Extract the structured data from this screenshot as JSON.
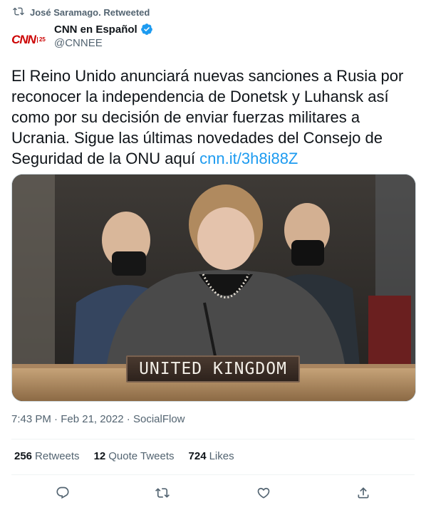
{
  "retweet": {
    "label": "José Saramago. Retweeted",
    "icon": "retweet-icon"
  },
  "author": {
    "display_name": "CNN en Español",
    "handle": "@CNNEE",
    "verified": true,
    "avatar_logo": "CNN 25"
  },
  "tweet": {
    "text": "El Reino Unido anunciará nuevas sanciones a Rusia por reconocer la independencia de Donetsk y Luhansk así como por su decisión de enviar fuerzas militares a Ucrania. Sigue las últimas novedades del Consejo de Seguridad de la ONU aquí ",
    "link": "cnn.it/3h8i88Z"
  },
  "media": {
    "nameplate": "UNITED KINGDOM"
  },
  "meta": {
    "time": "7:43 PM",
    "date": "Feb 21, 2022",
    "source": "SocialFlow"
  },
  "stats": {
    "retweets_count": "256",
    "retweets_label": "Retweets",
    "quotes_count": "12",
    "quotes_label": "Quote Tweets",
    "likes_count": "724",
    "likes_label": "Likes"
  },
  "colors": {
    "link": "#1d9bf0",
    "secondary_text": "#536471",
    "primary_text": "#0f1419",
    "verified": "#1d9bf0"
  }
}
